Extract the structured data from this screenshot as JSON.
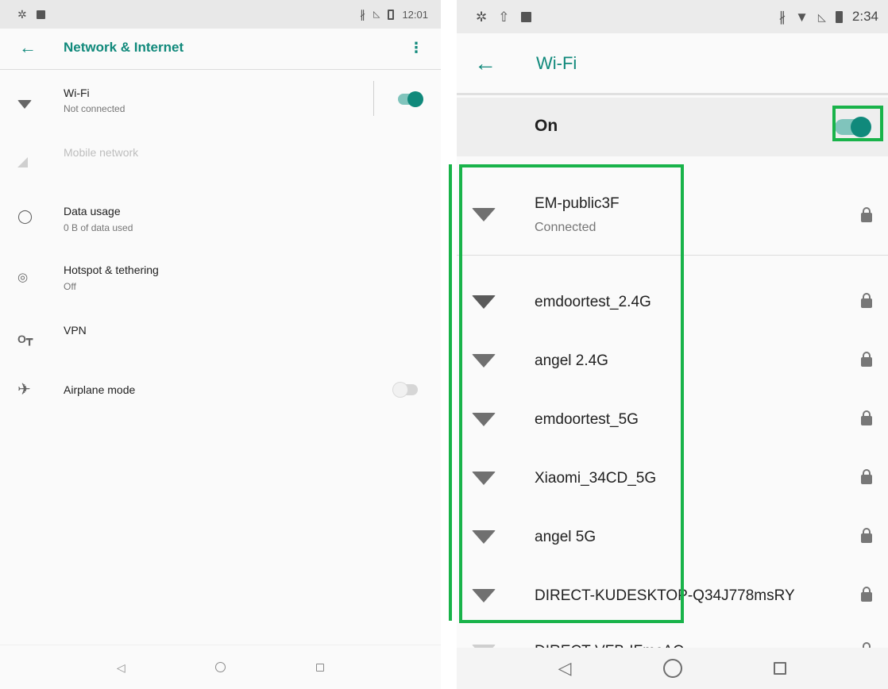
{
  "left": {
    "status_bar": {
      "time": "12:01"
    },
    "app_bar": {
      "title": "Network & Internet"
    },
    "items": [
      {
        "title": "Wi-Fi",
        "subtitle": "Not connected",
        "toggle": "on"
      },
      {
        "title": "Mobile network",
        "subtitle": "",
        "disabled": true
      },
      {
        "title": "Data usage",
        "subtitle": "0 B of data used"
      },
      {
        "title": "Hotspot & tethering",
        "subtitle": "Off"
      },
      {
        "title": "VPN",
        "subtitle": ""
      },
      {
        "title": "Airplane mode",
        "subtitle": "",
        "toggle": "off"
      }
    ]
  },
  "right": {
    "status_bar": {
      "time": "2:34"
    },
    "app_bar": {
      "title": "Wi-Fi"
    },
    "master": {
      "label": "On",
      "toggle": "on"
    },
    "networks": [
      {
        "name": "EM-public3F",
        "status": "Connected",
        "secured": true
      },
      {
        "name": "emdoortest_2.4G",
        "secured": true
      },
      {
        "name": "angel 2.4G",
        "secured": true
      },
      {
        "name": "emdoortest_5G",
        "secured": true
      },
      {
        "name": "Xiaomi_34CD_5G",
        "secured": true
      },
      {
        "name": "angel 5G",
        "secured": true
      },
      {
        "name": "DIRECT-KUDESKTOP-Q34J778msRY",
        "secured": true
      },
      {
        "name": "DIRECT-VFB-IFmcAC",
        "secured": true
      }
    ]
  },
  "colors": {
    "accent": "#10897b",
    "highlight": "#19b34a"
  }
}
